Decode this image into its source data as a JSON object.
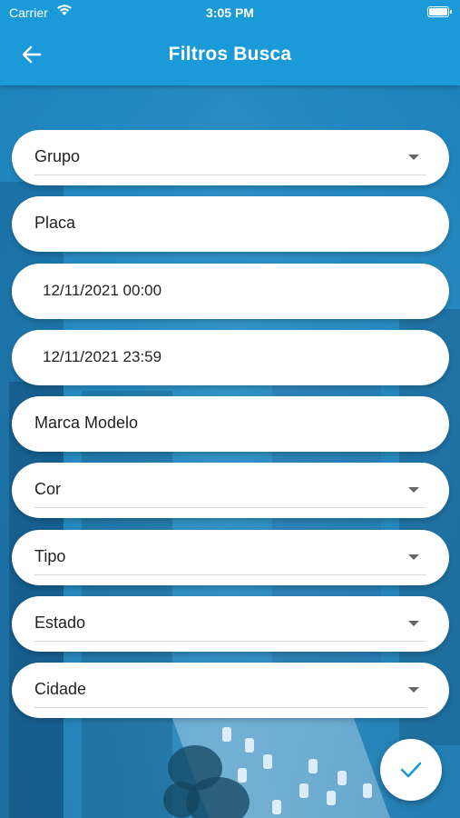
{
  "status_bar": {
    "carrier": "Carrier",
    "time": "3:05 PM"
  },
  "app_bar": {
    "title": "Filtros Busca",
    "back_icon": "arrow-left-icon"
  },
  "colors": {
    "primary": "#1b9ad8",
    "field_bg": "#ffffff",
    "text": "#222222"
  },
  "fields": [
    {
      "name": "grupo",
      "label": "Grupo",
      "type": "dropdown"
    },
    {
      "name": "placa",
      "label": "Placa",
      "type": "text"
    },
    {
      "name": "data-inicio",
      "label": "12/11/2021 00:00",
      "type": "date"
    },
    {
      "name": "data-fim",
      "label": "12/11/2021 23:59",
      "type": "date"
    },
    {
      "name": "marca-modelo",
      "label": "Marca Modelo",
      "type": "text"
    },
    {
      "name": "cor",
      "label": "Cor",
      "type": "dropdown"
    },
    {
      "name": "tipo",
      "label": "Tipo",
      "type": "dropdown"
    },
    {
      "name": "estado",
      "label": "Estado",
      "type": "dropdown"
    },
    {
      "name": "cidade",
      "label": "Cidade",
      "type": "dropdown"
    }
  ],
  "fab": {
    "icon": "check-icon"
  }
}
